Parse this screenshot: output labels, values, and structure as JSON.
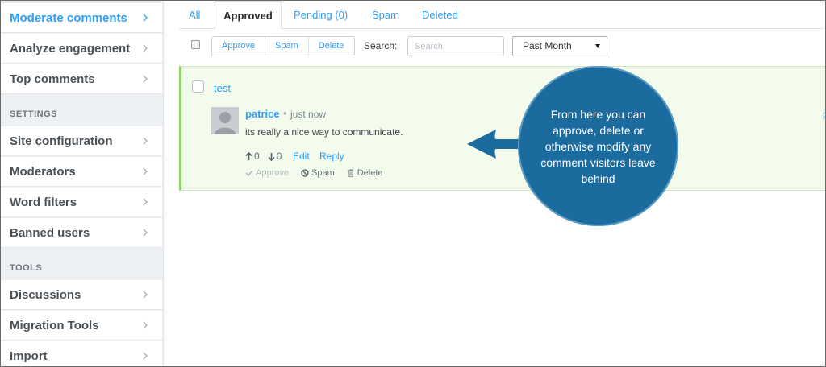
{
  "sidebar": {
    "items_top": [
      {
        "label": "Moderate comments",
        "active": true
      },
      {
        "label": "Analyze engagement",
        "active": false
      },
      {
        "label": "Top comments",
        "active": false
      }
    ],
    "settings_heading": "SETTINGS",
    "items_settings": [
      {
        "label": "Site configuration"
      },
      {
        "label": "Moderators"
      },
      {
        "label": "Word filters"
      },
      {
        "label": "Banned users"
      }
    ],
    "tools_heading": "TOOLS",
    "items_tools": [
      {
        "label": "Discussions"
      },
      {
        "label": "Migration Tools"
      },
      {
        "label": "Import"
      }
    ]
  },
  "tabs": [
    {
      "label": "All"
    },
    {
      "label": "Approved",
      "active": true
    },
    {
      "label": "Pending (0)"
    },
    {
      "label": "Spam"
    },
    {
      "label": "Deleted"
    }
  ],
  "toolbar": {
    "approve_label": "Approve",
    "spam_label": "Spam",
    "delete_label": "Delete",
    "search_label": "Search:",
    "search_placeholder": "Search",
    "range_selected": "Past Month"
  },
  "comment": {
    "thread_title": "test",
    "author": "patrice",
    "separator": "•",
    "time": "just now",
    "message": "its really a nice way to communicate.",
    "upvotes": "0",
    "downvotes": "0",
    "edit_label": "Edit",
    "reply_label": "Reply",
    "approve_label": "Approve",
    "spam_label": "Spam",
    "delete_label": "Delete",
    "cut_text": "p"
  },
  "callout": {
    "text": "From here you can approve, delete or otherwise modify any comment visitors leave behind"
  },
  "colors": {
    "accent": "#2e9fff",
    "approved_bg": "#f2fbec",
    "approved_border": "#8fd06a",
    "callout_bg": "#1c6b9e"
  }
}
